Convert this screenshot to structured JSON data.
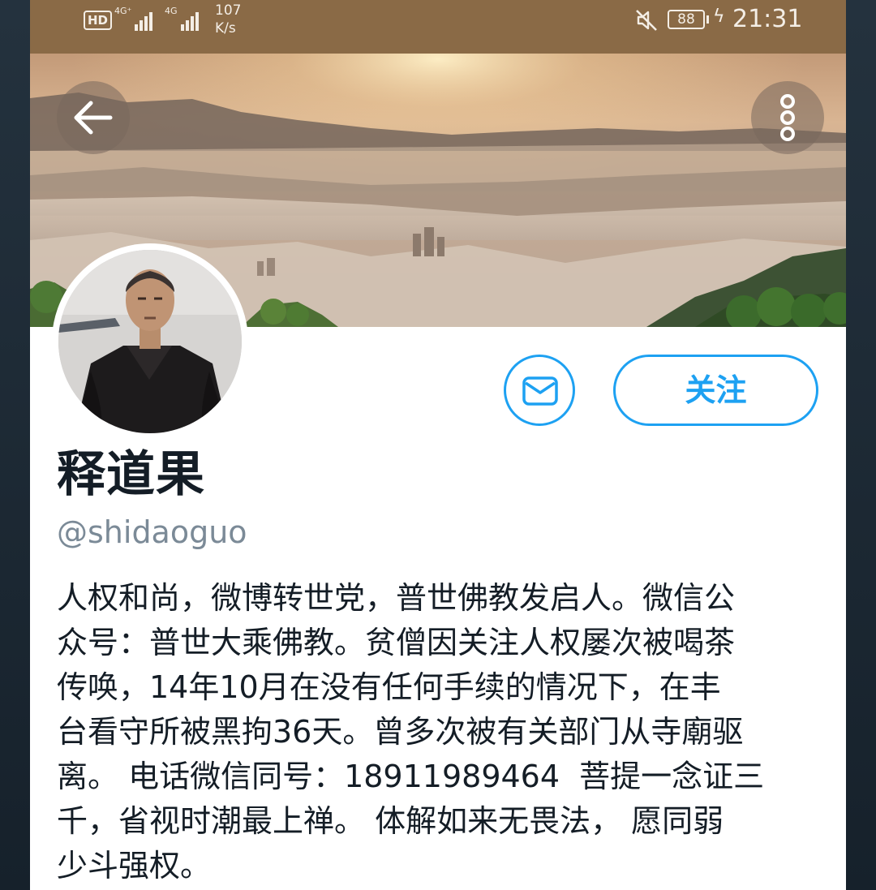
{
  "status_bar": {
    "hd_badge": "HD",
    "signal1_label": "4G⁺",
    "signal2_label": "4G",
    "speed_value": "107",
    "speed_unit": "K/s",
    "battery": "88",
    "time": "21:31"
  },
  "header": {
    "back_icon": "arrow-left-icon",
    "more_icon": "more-vertical-icon"
  },
  "profile": {
    "name": "释道果",
    "handle": "@shidaoguo",
    "bio": "人权和尚，微博转世党，普世佛教发启人。微信公\n众号：普世大乘佛教。贫僧因关注人权屡次被喝茶\n传唤，14年10月在没有任何手续的情况下，在丰\n台看守所被黑拘36天。曾多次被有关部门从寺廟驱\n离。 电话微信同号：18911989464  菩提一念证三\n千，省视时潮最上禅。 体解如来无畏法， 愿同弱\n少斗强权。"
  },
  "actions": {
    "message_icon": "envelope-icon",
    "follow_label": "关注"
  },
  "colors": {
    "accent": "#1da1f2",
    "text_primary": "#141d26",
    "text_secondary": "#7b8a97",
    "status_bar_bg": "#8a6a46"
  }
}
